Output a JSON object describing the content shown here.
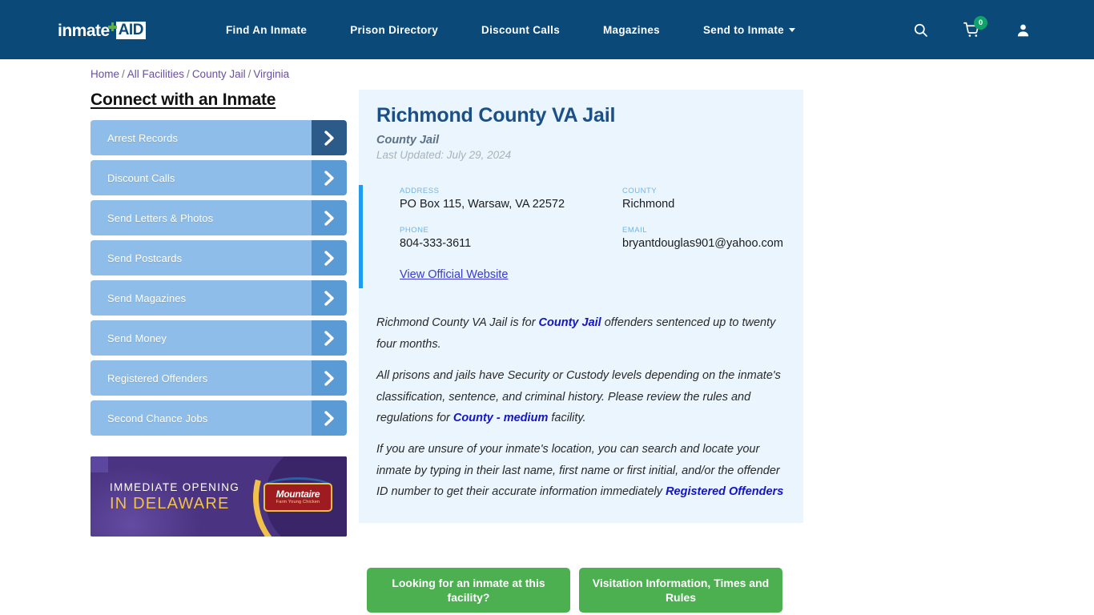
{
  "header": {
    "logo": {
      "word": "inmate",
      "aid": "AID",
      "cross_color": "#5cb23c"
    },
    "nav": [
      {
        "label": "Find An Inmate",
        "has_caret": false
      },
      {
        "label": "Prison Directory",
        "has_caret": false
      },
      {
        "label": "Discount Calls",
        "has_caret": false
      },
      {
        "label": "Magazines",
        "has_caret": false
      },
      {
        "label": "Send to Inmate",
        "has_caret": true
      }
    ],
    "icons": {
      "search": "search-icon",
      "cart": "shopping-cart-icon",
      "account": "user-account-icon"
    },
    "cart_count": "0",
    "background": "#0b4978",
    "badge_color": "#0fa36b"
  },
  "breadcrumb": {
    "items": [
      "Home",
      "All Facilities",
      "County Jail",
      "Virginia"
    ],
    "separator": "/"
  },
  "sidebar": {
    "title": "Connect with an Inmate",
    "items": [
      {
        "label": "Arrest Records",
        "active": true
      },
      {
        "label": "Discount Calls",
        "active": false
      },
      {
        "label": "Send Letters & Photos",
        "active": false
      },
      {
        "label": "Send Postcards",
        "active": false
      },
      {
        "label": "Send Magazines",
        "active": false
      },
      {
        "label": "Send Money",
        "active": false
      },
      {
        "label": "Registered Offenders",
        "active": false
      },
      {
        "label": "Second Chance Jobs",
        "active": false
      }
    ],
    "button_color": "#8dbde8",
    "chevron_color": "#5b9bd5",
    "chevron_active_color": "#2c5b8a"
  },
  "ad": {
    "line1": "IMMEDIATE OPENING",
    "line2": "IN DELAWARE",
    "brand": "Mountaire",
    "brand_sub": "Farm Young Chicken",
    "bg_color": "#4a3380",
    "accent_color": "#f2c14a"
  },
  "facility": {
    "title": "Richmond County VA Jail",
    "type": "County Jail",
    "last_updated": "Last Updated: July 29, 2024",
    "fields": [
      {
        "label": "ADDRESS",
        "value": "PO Box 115, Warsaw, VA 22572"
      },
      {
        "label": "COUNTY",
        "value": "Richmond"
      },
      {
        "label": "PHONE",
        "value": "804-333-3611"
      },
      {
        "label": "EMAIL",
        "value": "bryantdouglas901@yahoo.com"
      }
    ],
    "website_link": "View Official Website",
    "accent_bar_color": "#1f9bf0",
    "card_bg": "#eaf5fd"
  },
  "description": {
    "p1_a": "Richmond County VA Jail is for ",
    "p1_link": "County Jail",
    "p1_b": " offenders sentenced up to twenty four months.",
    "p2_a": "All prisons and jails have Security or Custody levels depending on the inmate's classification, sentence, and criminal history. Please review the rules and regulations for ",
    "p2_link": "County - medium",
    "p2_b": " facility.",
    "p3_a": "If you are unsure of your inmate's location, you can search and locate your inmate by typing in their last name, first name or first initial, and/or the offender ID number to get their accurate information immediately ",
    "p3_link": "Registered Offenders"
  },
  "cta": {
    "button1": "Looking for an inmate at this facility?",
    "button2": "Visitation Information, Times and Rules",
    "color": "#4caf50"
  }
}
